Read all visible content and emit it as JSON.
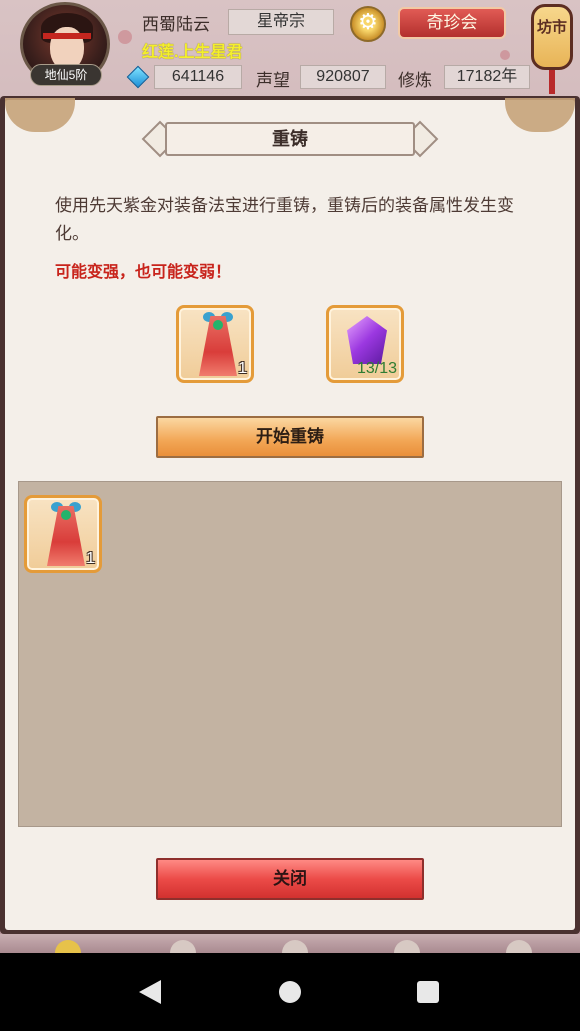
{
  "header": {
    "player_name": "西蜀陆云",
    "sect": "星帝宗",
    "title": "红莲.上生星君",
    "rank": "地仙5阶",
    "treasure_label": "奇珍会",
    "market_label": "坊市",
    "gems": "641146",
    "reputation_label": "声望",
    "reputation": "920807",
    "cultivation_label": "修炼",
    "cultivation": "17182年"
  },
  "dialog": {
    "title": "重铸",
    "description": "使用先天紫金对装备法宝进行重铸，重铸后的装备属性发生变化。",
    "warning": "可能变强，也可能变弱！",
    "equipment_slot": {
      "icon": "red-robe-icon",
      "count": "1"
    },
    "material_slot": {
      "icon": "purple-crystal-icon",
      "count": "13/13"
    },
    "start_label": "开始重铸",
    "inventory": [
      {
        "icon": "red-robe-icon",
        "count": "1"
      }
    ],
    "close_label": "关闭"
  },
  "colors": {
    "accent_orange": "#f2a655",
    "close_red": "#ec4b48",
    "warning_red": "#c8241c",
    "title_yellow": "#f4ef2c"
  }
}
